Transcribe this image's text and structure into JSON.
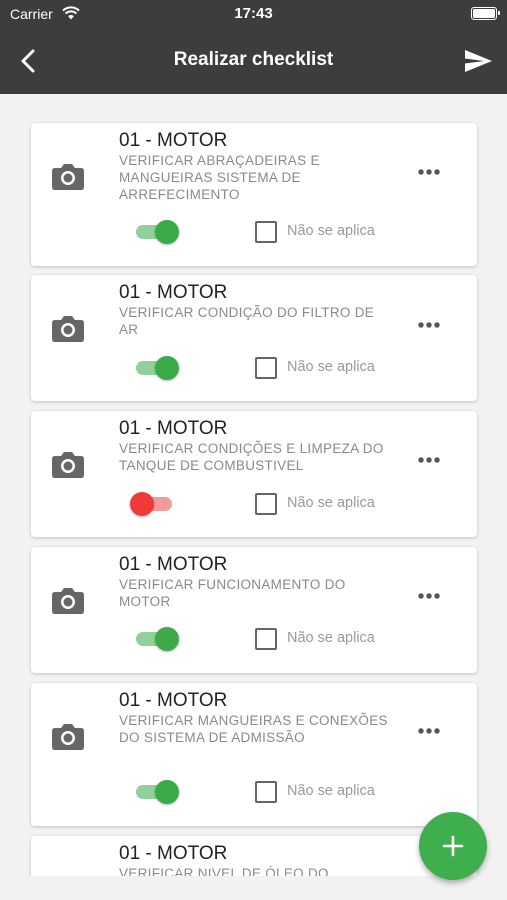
{
  "status_bar": {
    "carrier": "Carrier",
    "time": "17:43"
  },
  "nav": {
    "title": "Realizar checklist",
    "back_icon": "chevron-left-icon",
    "send_icon": "send-icon"
  },
  "colors": {
    "header_bg": "#3d3d3d",
    "accent_green": "#3fae4c",
    "off_red": "#f03a3a"
  },
  "items": [
    {
      "title": "01 - MOTOR",
      "description": "VERIFICAR ABRAÇADEIRAS E MANGUEIRAS SISTEMA DE ARREFECIMENTO",
      "toggle_on": true,
      "na_checked": false,
      "na_label": "Não se aplica"
    },
    {
      "title": "01 - MOTOR",
      "description": "VERIFICAR CONDIÇÃO DO FILTRO DE AR",
      "toggle_on": true,
      "na_checked": false,
      "na_label": "Não se aplica"
    },
    {
      "title": "01 - MOTOR",
      "description": "VERIFICAR CONDIÇÕES E LIMPEZA DO TANQUE DE COMBUSTIVEL",
      "toggle_on": false,
      "na_checked": false,
      "na_label": "Não se aplica"
    },
    {
      "title": "01 - MOTOR",
      "description": "VERIFICAR FUNCIONAMENTO DO MOTOR",
      "toggle_on": true,
      "na_checked": false,
      "na_label": "Não se aplica"
    },
    {
      "title": "01 - MOTOR",
      "description": "VERIFICAR MANGUEIRAS E CONEXÕES DO SISTEMA DE ADMISSÃO",
      "toggle_on": true,
      "na_checked": false,
      "na_label": "Não se aplica"
    },
    {
      "title": "01 - MOTOR",
      "description": "VERIFICAR NIVEL DE ÓLEO DO"
    }
  ],
  "fab": {
    "icon": "plus-icon"
  }
}
